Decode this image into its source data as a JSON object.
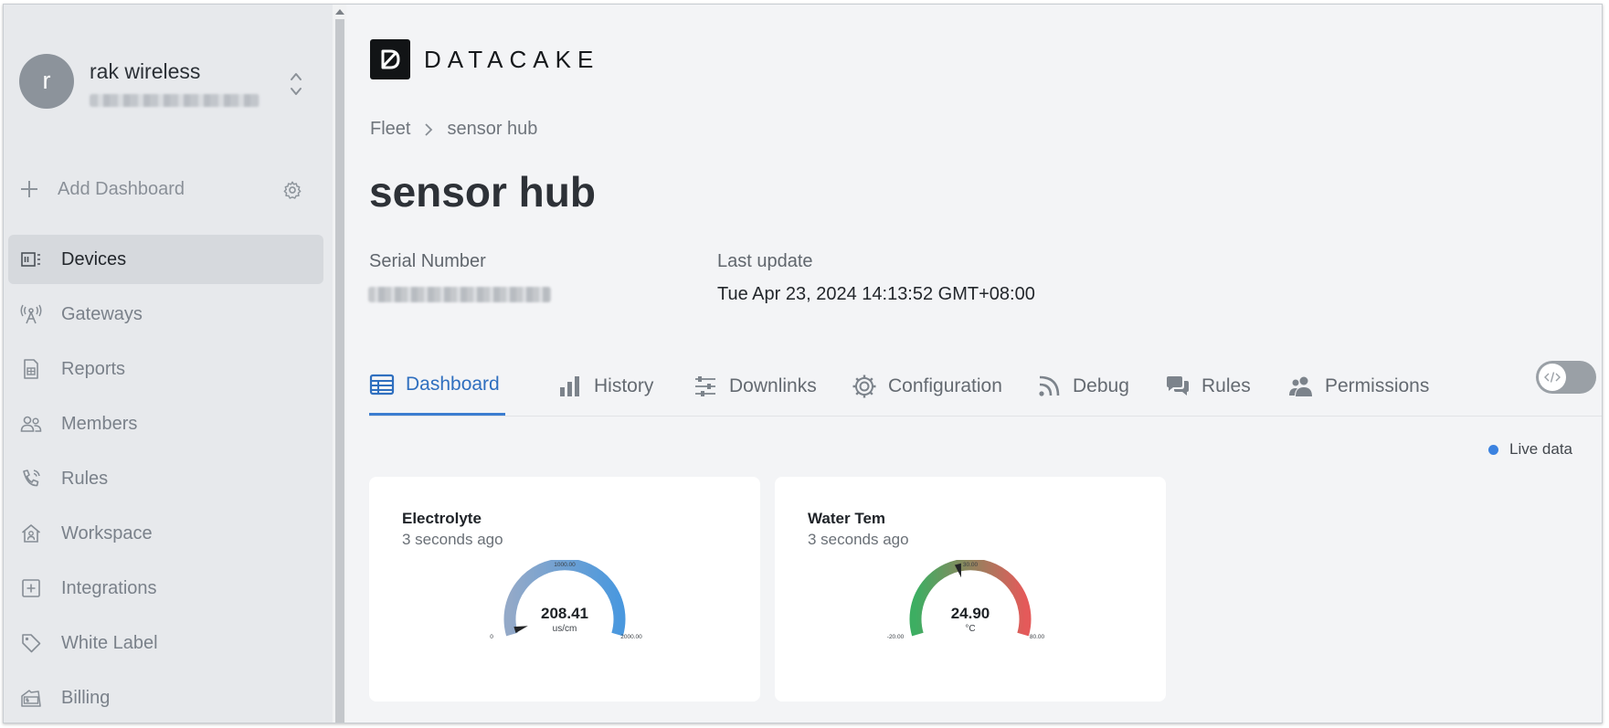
{
  "sidebar": {
    "avatar_letter": "r",
    "org_name": "rak wireless",
    "add_dashboard": "Add Dashboard",
    "items": [
      {
        "label": "Devices",
        "icon": "devices-icon",
        "active": true
      },
      {
        "label": "Gateways",
        "icon": "gateway-antenna-icon"
      },
      {
        "label": "Reports",
        "icon": "report-document-icon"
      },
      {
        "label": "Members",
        "icon": "members-icon"
      },
      {
        "label": "Rules",
        "icon": "rules-phone-icon"
      },
      {
        "label": "Workspace",
        "icon": "workspace-house-icon"
      },
      {
        "label": "Integrations",
        "icon": "integrations-plus-box-icon"
      },
      {
        "label": "White Label",
        "icon": "tag-icon"
      },
      {
        "label": "Billing",
        "icon": "billing-icon"
      }
    ]
  },
  "brand": {
    "logo_text": "DATACAKE"
  },
  "breadcrumb": {
    "root": "Fleet",
    "current": "sensor hub"
  },
  "device": {
    "title": "sensor hub",
    "serial_label": "Serial Number",
    "last_update_label": "Last update",
    "last_update_value": "Tue Apr 23, 2024 14:13:52 GMT+08:00"
  },
  "tabs": [
    {
      "label": "Dashboard",
      "icon": "table-icon",
      "active": true
    },
    {
      "label": "History",
      "icon": "bar-chart-icon"
    },
    {
      "label": "Downlinks",
      "icon": "sliders-icon"
    },
    {
      "label": "Configuration",
      "icon": "gear-icon"
    },
    {
      "label": "Debug",
      "icon": "rss-icon"
    },
    {
      "label": "Rules",
      "icon": "comments-icon"
    },
    {
      "label": "Permissions",
      "icon": "users-icon"
    }
  ],
  "live_data_label": "Live data",
  "widgets": [
    {
      "title": "Electrolyte",
      "subtitle": "3 seconds ago",
      "value": "208.41",
      "unit": "us/cm",
      "min_label": "0",
      "mid_label": "1000.00",
      "max_label": "2000.00",
      "min": 0,
      "max": 2000,
      "reading": 208.41,
      "colors": [
        "#93a9c8",
        "#4a98de"
      ]
    },
    {
      "title": "Water Tem",
      "subtitle": "3 seconds ago",
      "value": "24.90",
      "unit": "°C",
      "min_label": "-20.00",
      "mid_label": "30.00",
      "max_label": "80.00",
      "min": -20,
      "max": 80,
      "reading": 24.9,
      "colors": [
        "#3dae62",
        "#e45a5a"
      ]
    }
  ],
  "colors": {
    "accent": "#3b7dd0",
    "live_dot": "#3b82e0",
    "sidebar_bg": "#e7e9ec"
  }
}
